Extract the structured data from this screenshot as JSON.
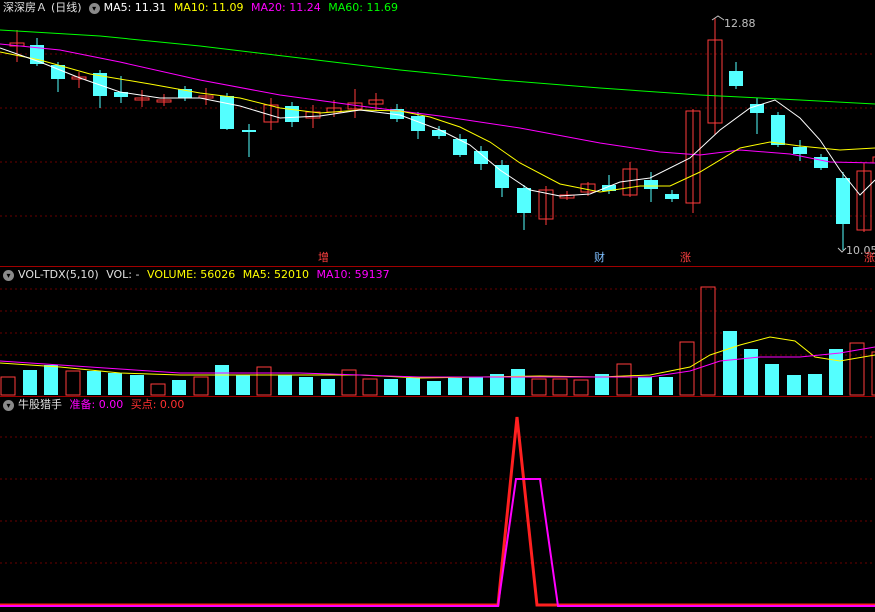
{
  "main": {
    "stock_name": "深深房Ａ",
    "period": "(日线)",
    "ma5": "MA5: 11.31",
    "ma10": "MA10: 11.09",
    "ma20": "MA20: 11.24",
    "ma60": "MA60: 11.69",
    "high_label": "12.88",
    "low_label": "10.05",
    "markers": [
      "增",
      "财",
      "涨",
      "涨"
    ]
  },
  "vol": {
    "indicator": "VOL-TDX(5,10)",
    "vol_label": "VOL: -",
    "volume": "VOLUME: 56026",
    "ma5": "MA5: 52010",
    "ma10": "MA10: 59137"
  },
  "signal": {
    "indicator": "牛股猎手",
    "prepare": "准备: 0.00",
    "buy": "买点: 0.00"
  },
  "colors": {
    "up": "#ff3c3c",
    "down": "#54ffff",
    "ma5": "#ffffff",
    "ma10": "#ffff00",
    "ma20": "#ff00ff",
    "ma60": "#00ff00",
    "separator": "#a00000"
  },
  "chart_data": [
    {
      "type": "candlestick",
      "high_marker": 12.88,
      "low_marker": 10.05,
      "series": [
        {
          "name": "MA5",
          "value": 11.31
        },
        {
          "name": "MA10",
          "value": 11.09
        },
        {
          "name": "MA20",
          "value": 11.24
        },
        {
          "name": "MA60",
          "value": 11.69
        }
      ]
    },
    {
      "type": "bar",
      "series": [
        {
          "name": "VOLUME",
          "value": 56026
        },
        {
          "name": "MA5",
          "value": 52010
        },
        {
          "name": "MA10",
          "value": 59137
        }
      ]
    },
    {
      "type": "line",
      "series": [
        {
          "name": "准备",
          "value": 0.0
        },
        {
          "name": "买点",
          "value": 0.0
        }
      ]
    }
  ]
}
